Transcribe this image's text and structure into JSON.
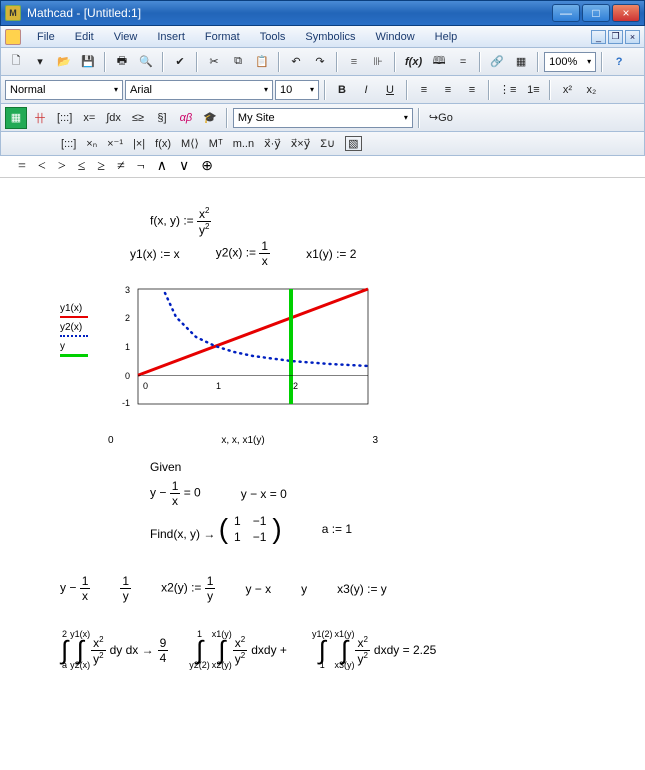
{
  "title": "Mathcad - [Untitled:1]",
  "window_controls": {
    "min": "—",
    "max": "□",
    "close": "×",
    "mini_min": "_",
    "mini_restore": "❐",
    "mini_close": "×"
  },
  "menu": [
    "File",
    "Edit",
    "View",
    "Insert",
    "Format",
    "Tools",
    "Symbolics",
    "Window",
    "Help"
  ],
  "toolbar1": {
    "zoom": "100%"
  },
  "toolbar2": {
    "style": "Normal",
    "font": "Arial",
    "size": "10",
    "bold": "B",
    "italic": "I",
    "underline": "U"
  },
  "toolbar3": {
    "site": "My Site",
    "go": "Go"
  },
  "palette": [
    "[:::]",
    "×ₙ",
    "×⁻¹",
    "|×|",
    "f(x)",
    "M⟨⟩",
    "Mᵀ",
    "m..n",
    "x⃗·y⃗",
    "x⃗×y⃗",
    "Σ∪"
  ],
  "opsbar": [
    "=",
    "<",
    ">",
    "≤",
    "≥",
    "≠",
    "¬",
    "∧",
    "∨",
    "⊕"
  ],
  "doc": {
    "eq1": "f(x, y) :=",
    "eq1_num": "x",
    "eq1_den": "y",
    "y1": "y1(x) := x",
    "y2a": "y2(x) :=",
    "y2_num": "1",
    "y2_den": "x",
    "x1": "x1(y) := 2",
    "legend": {
      "y1": "y1(x)",
      "y2": "y2(x)",
      "y": "y"
    },
    "xaxis_lo": "0",
    "xaxis_label": "x, x, x1(y)",
    "xaxis_hi": "3",
    "given": "Given",
    "g1a": "y −",
    "g1_num": "1",
    "g1_den": "x",
    "g1b": "= 0",
    "g2": "y − x = 0",
    "find": "Find(x, y)  →",
    "m11": "1",
    "m12": "−1",
    "m21": "1",
    "m22": "−1",
    "a_assign": "a := 1",
    "r1a": "y −",
    "r1n": "1",
    "r1d": "x",
    "r2n": "1",
    "r2d": "y",
    "r3": "x2(y) :=",
    "r3n": "1",
    "r3d": "y",
    "r4": "y − x",
    "r5": "y",
    "r6": "x3(y) := y",
    "int1_up": "2",
    "int1_lo": "a",
    "int1b_up": "y1(x)",
    "int1b_lo": "y2(x)",
    "int1_fn": "x",
    "int1_fd": "y",
    "int1_dy": "dy dx  →",
    "int1_res_n": "9",
    "int1_res_d": "4",
    "int2a_up": "1",
    "int2a_lo": "y2(2)",
    "int2b_up": "x1(y)",
    "int2b_lo": "x2(y)",
    "int2_fn": "x",
    "int2_fd": "y",
    "int2_dy": "dxdy +",
    "int3a_up": "y1(2)",
    "int3a_lo": "1",
    "int3b_up": "x1(y)",
    "int3b_lo": "x3(y)",
    "int3_fn": "x",
    "int3_fd": "y",
    "int3_dy": "dxdy = 2.25"
  },
  "chart_data": {
    "type": "line",
    "xlabel": "x, x, x1(y)",
    "ylabel": "",
    "xlim": [
      0,
      3
    ],
    "ylim": [
      -1,
      3
    ],
    "x_ticks": [
      0,
      1,
      2,
      3
    ],
    "y_ticks": [
      -1,
      0,
      1,
      2,
      3
    ],
    "series": [
      {
        "name": "y1(x)",
        "color": "#e60000",
        "style": "solid",
        "x": [
          0,
          0.5,
          1,
          1.5,
          2,
          2.5,
          3
        ],
        "values": [
          0,
          0.5,
          1,
          1.5,
          2,
          2.5,
          3
        ]
      },
      {
        "name": "y2(x)",
        "color": "#0020c0",
        "style": "dotted",
        "x": [
          0.35,
          0.5,
          0.75,
          1,
          1.25,
          1.5,
          2,
          2.5,
          3
        ],
        "values": [
          2.86,
          2,
          1.33,
          1,
          0.8,
          0.67,
          0.5,
          0.4,
          0.33
        ]
      },
      {
        "name": "y",
        "color": "#00d000",
        "style": "solid",
        "x": [
          2,
          2
        ],
        "values": [
          -1,
          3
        ]
      }
    ]
  }
}
